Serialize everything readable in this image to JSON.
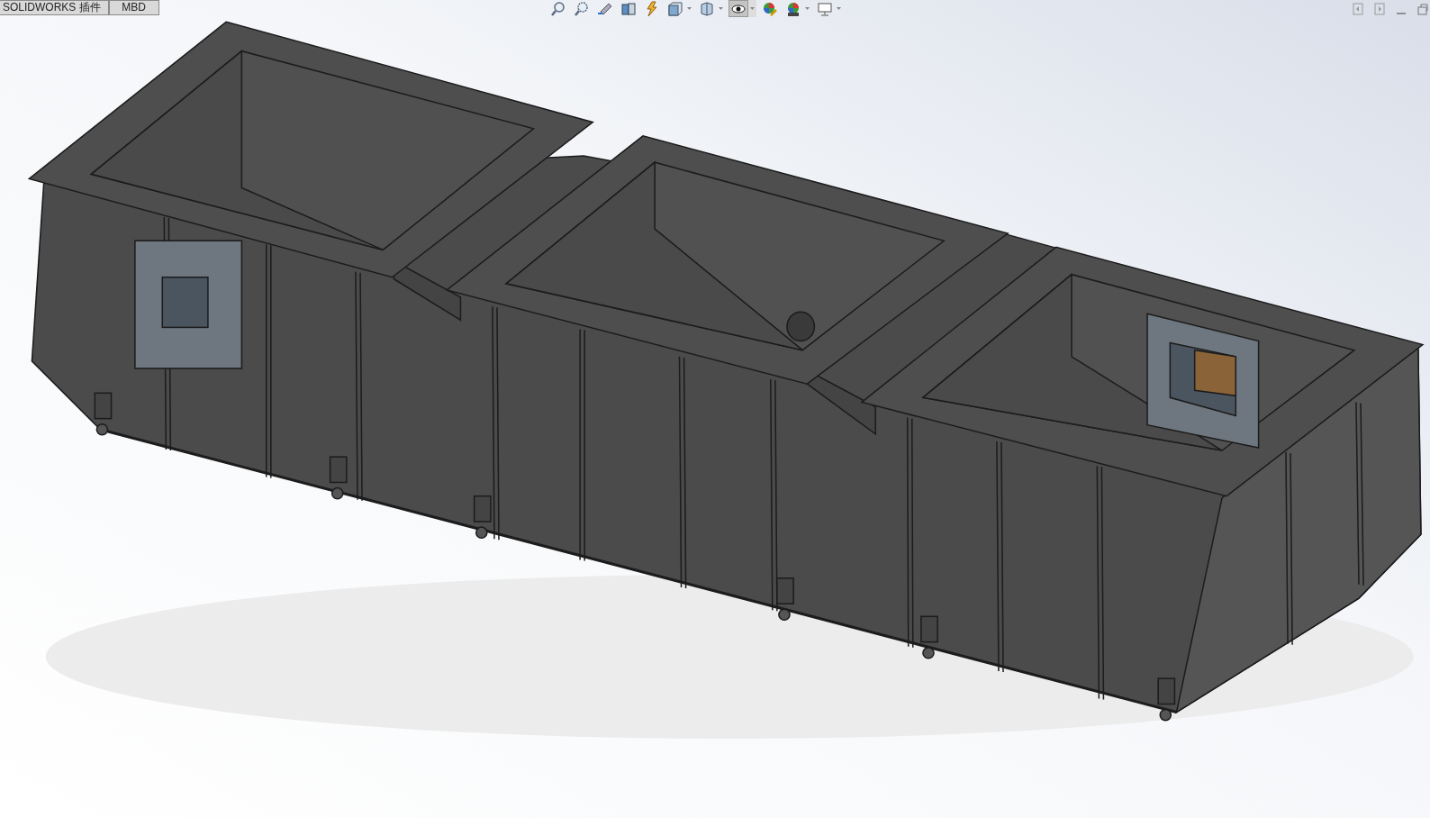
{
  "tabs": [
    {
      "label": "SOLIDWORKS 插件",
      "selected": false
    },
    {
      "label": "MBD",
      "selected": false
    }
  ],
  "view_toolbar": [
    {
      "kind": "zoom-fit",
      "active": false,
      "dropdown": false
    },
    {
      "kind": "zoom-area",
      "active": false,
      "dropdown": false
    },
    {
      "kind": "previous-view",
      "active": false,
      "dropdown": false
    },
    {
      "kind": "section-view",
      "active": false,
      "dropdown": false
    },
    {
      "kind": "dynamic-annotation",
      "active": false,
      "dropdown": false
    },
    {
      "kind": "view-orientation",
      "active": false,
      "dropdown": true
    },
    {
      "kind": "display-style",
      "active": false,
      "dropdown": true
    },
    {
      "kind": "hide-show",
      "active": true,
      "dropdown": true
    },
    {
      "kind": "edit-appearance",
      "active": false,
      "dropdown": false
    },
    {
      "kind": "apply-scene",
      "active": false,
      "dropdown": true
    },
    {
      "kind": "view-settings",
      "active": false,
      "dropdown": true
    }
  ]
}
